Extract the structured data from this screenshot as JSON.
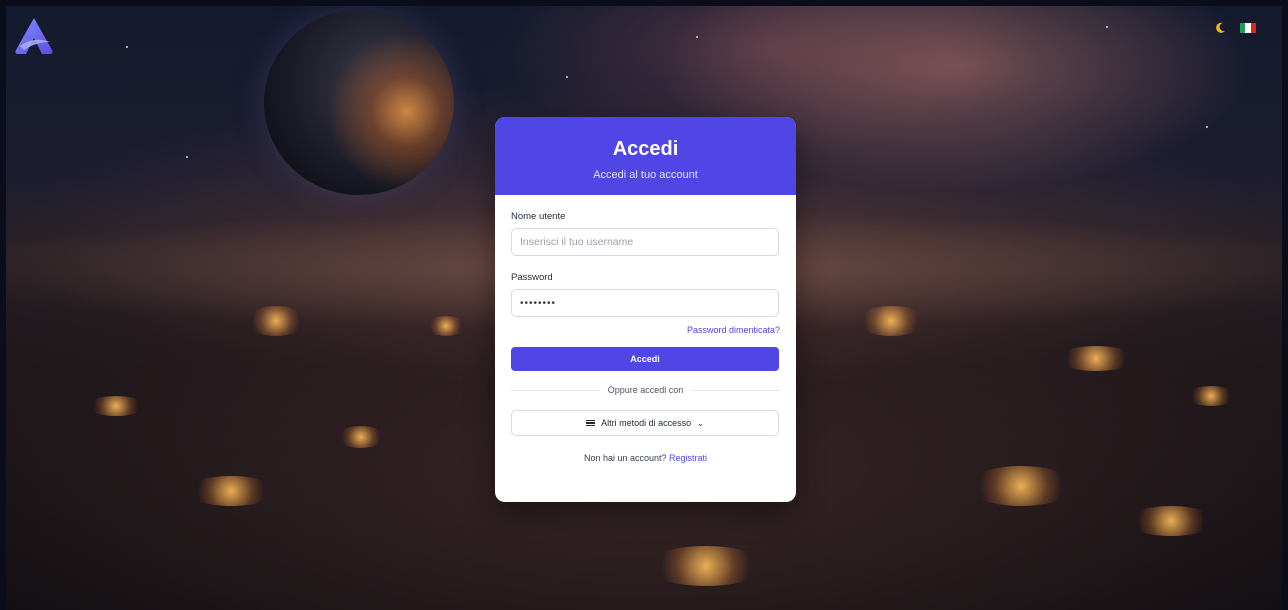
{
  "header": {
    "title": "Accedi",
    "subtitle": "Accedi al tuo account"
  },
  "username": {
    "label": "Nome utente",
    "placeholder": "Inserisci il tuo username",
    "value": ""
  },
  "password": {
    "label": "Password",
    "value": "••••••••"
  },
  "forgot_password": "Password dimenticata?",
  "submit_label": "Accedi",
  "divider_text": "Oppure accedi con",
  "alt_methods_label": "Altri metodi di accesso",
  "signup": {
    "prompt": "Non hai un account?",
    "link": "Registrati"
  },
  "colors": {
    "accent": "#4f46e5",
    "card_bg": "#ffffff",
    "moon": "#f5b90b"
  },
  "icons": {
    "theme_toggle": "moon-icon",
    "language": "flag-icon-italy",
    "logo": "app-logo",
    "menu": "hamburger-icon",
    "dropdown": "chevron-down-icon"
  }
}
